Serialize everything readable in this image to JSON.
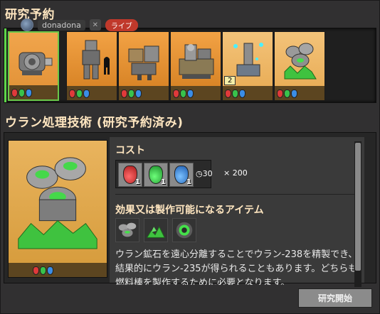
{
  "queue": {
    "title": "研究予約",
    "items": [
      {
        "icon": "electric-motor-icon",
        "packs": [
          "red",
          "green",
          "blue"
        ],
        "queue_number": ""
      },
      {
        "icon": "exoskeleton-icon",
        "packs": [
          "red",
          "green",
          "blue"
        ],
        "queue_number": ""
      },
      {
        "icon": "power-armor-icon",
        "packs": [
          "red",
          "green",
          "blue"
        ],
        "queue_number": ""
      },
      {
        "icon": "assembling-machine-icon",
        "packs": [
          "red",
          "green",
          "blue"
        ],
        "queue_number": ""
      },
      {
        "icon": "uranium-mining-icon",
        "packs": [
          "red",
          "green",
          "blue"
        ],
        "queue_number": "2"
      },
      {
        "icon": "uranium-processing-icon",
        "packs": [
          "red",
          "green",
          "blue"
        ],
        "queue_number": ""
      }
    ]
  },
  "stream_overlay": {
    "username": "donadona",
    "live_label": "ライブ"
  },
  "detail": {
    "title": "ウラン処理技術 (研究予約済み)",
    "cost_heading": "コスト",
    "cost_items": [
      {
        "pack": "red",
        "count": "1"
      },
      {
        "pack": "green",
        "count": "1"
      },
      {
        "pack": "blue",
        "count": "1"
      }
    ],
    "time": "30",
    "multiplier": "× 200",
    "unlock_heading": "効果又は製作可能になるアイテム",
    "unlocks": [
      "centrifuge-icon",
      "uranium-fuel-icon",
      "uranium-ammo-icon"
    ],
    "description": "ウラン鉱石を遠心分離することでウラン-238を精製でき、結果的にウラン-235が得られることもあります。どちらも燃料棒を製作するために必要となります。"
  },
  "actions": {
    "start_label": "研究開始"
  },
  "colors": {
    "accent_title": "#ffe6c0",
    "tech_bg": "#e09035",
    "queue_active": "#5fd84a"
  }
}
